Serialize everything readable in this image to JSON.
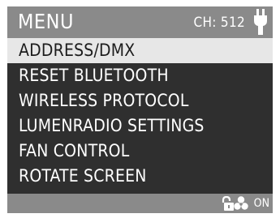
{
  "header": {
    "title": "MENU",
    "channel": "CH: 512",
    "power_icon": "plug-icon"
  },
  "menu": {
    "items": [
      {
        "label": "ADDRESS/DMX",
        "selected": true
      },
      {
        "label": "RESET BLUETOOTH",
        "selected": false
      },
      {
        "label": "WIRELESS PROTOCOL",
        "selected": false
      },
      {
        "label": "LUMENRADIO SETTINGS",
        "selected": false
      },
      {
        "label": "FAN CONTROL",
        "selected": false
      },
      {
        "label": "ROTATE SCREEN",
        "selected": false
      }
    ]
  },
  "footer": {
    "lock_icon": "unlocked-icon",
    "fan_icon": "fan-icon",
    "fan_status": "ON"
  },
  "colors": {
    "bar_gray": "#8a8a8a",
    "screen_dark": "#2f2f2f",
    "selected_bg": "#e7e7e7",
    "text_white": "#ffffff",
    "selected_text": "#1d1d1d"
  }
}
